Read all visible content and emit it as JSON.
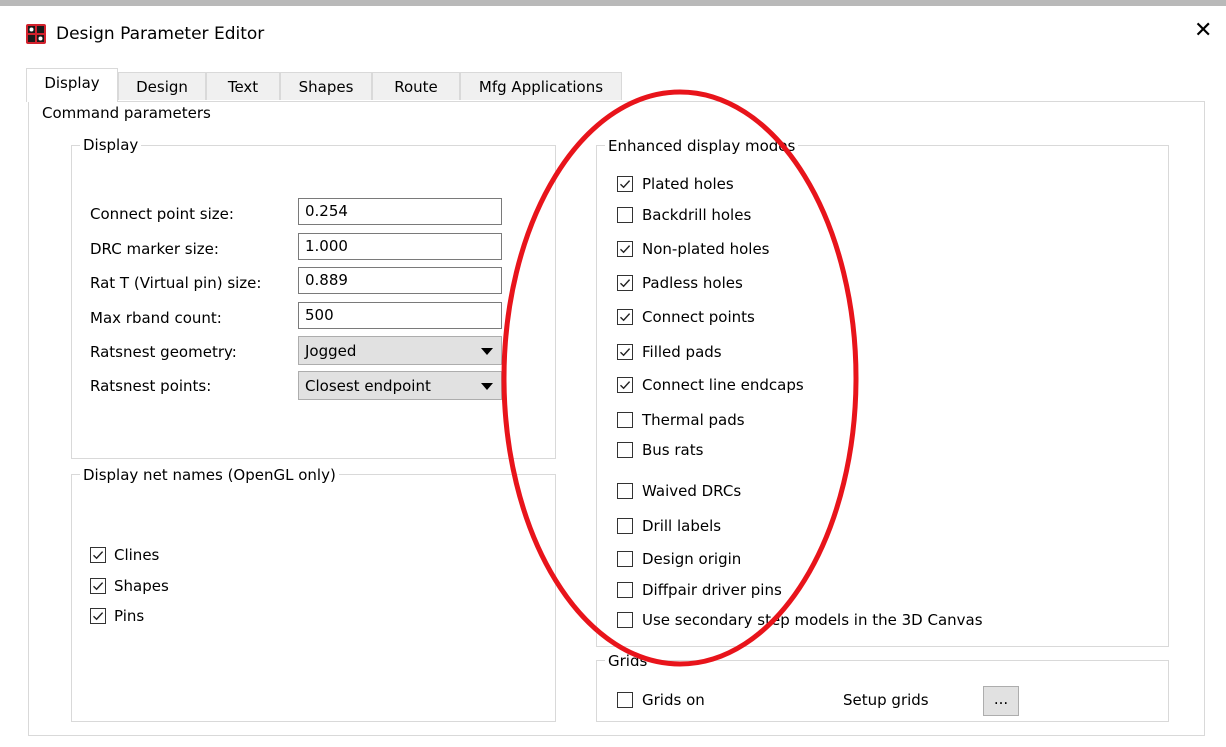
{
  "window": {
    "title": "Design Parameter Editor",
    "close_glyph": "✕"
  },
  "tabs": [
    {
      "label": "Display",
      "active": true
    },
    {
      "label": "Design",
      "active": false
    },
    {
      "label": "Text",
      "active": false
    },
    {
      "label": "Shapes",
      "active": false
    },
    {
      "label": "Route",
      "active": false
    },
    {
      "label": "Mfg Applications",
      "active": false
    }
  ],
  "command_parameters": {
    "title": "Command parameters"
  },
  "display": {
    "title": "Display",
    "fields": [
      {
        "label": "Connect point size:",
        "value": "0.254"
      },
      {
        "label": "DRC marker size:",
        "value": "1.000"
      },
      {
        "label": "Rat T (Virtual pin) size:",
        "value": "0.889"
      },
      {
        "label": "Max rband count:",
        "value": "500"
      }
    ],
    "selects": [
      {
        "label": "Ratsnest geometry:",
        "value": "Jogged"
      },
      {
        "label": "Ratsnest points:",
        "value": "Closest endpoint"
      }
    ]
  },
  "net_names": {
    "title": "Display net names (OpenGL only)",
    "items": [
      {
        "label": "Clines",
        "checked": true
      },
      {
        "label": "Shapes",
        "checked": true
      },
      {
        "label": "Pins",
        "checked": true
      }
    ]
  },
  "enhanced": {
    "title": "Enhanced display modes",
    "items": [
      {
        "label": "Plated holes",
        "checked": true
      },
      {
        "label": "Backdrill holes",
        "checked": false
      },
      {
        "label": "Non-plated holes",
        "checked": true
      },
      {
        "label": "Padless holes",
        "checked": true
      },
      {
        "label": "Connect points",
        "checked": true
      },
      {
        "label": "Filled pads",
        "checked": true
      },
      {
        "label": "Connect line endcaps",
        "checked": true
      },
      {
        "label": "Thermal pads",
        "checked": false
      },
      {
        "label": "Bus rats",
        "checked": false
      },
      {
        "label": "Waived DRCs",
        "checked": false
      },
      {
        "label": "Drill labels",
        "checked": false
      },
      {
        "label": "Design origin",
        "checked": false
      },
      {
        "label": "Diffpair driver pins",
        "checked": false
      },
      {
        "label": "Use secondary step models in the 3D Canvas",
        "checked": false
      }
    ]
  },
  "grids": {
    "title": "Grids",
    "grids_on": {
      "label": "Grids on",
      "checked": false
    },
    "setup_label": "Setup grids",
    "setup_button": "..."
  },
  "colors": {
    "annotation": "#e8141b",
    "border": "#d9d9d9"
  }
}
